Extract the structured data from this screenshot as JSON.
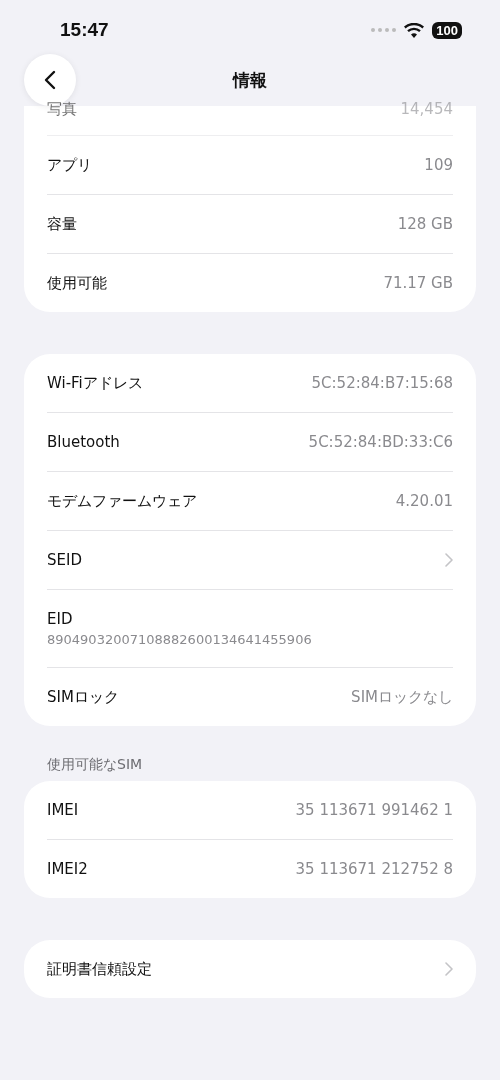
{
  "status_bar": {
    "time": "15:47",
    "battery": "100"
  },
  "nav": {
    "title": "情報"
  },
  "sections": [
    {
      "rows": [
        {
          "kind": "obscured",
          "label": "写真",
          "value": "14,454"
        },
        {
          "kind": "value",
          "label": "アプリ",
          "value": "109"
        },
        {
          "kind": "value",
          "label": "容量",
          "value": "128 GB"
        },
        {
          "kind": "value",
          "label": "使用可能",
          "value": "71.17 GB"
        }
      ]
    },
    {
      "rows": [
        {
          "kind": "value",
          "label": "Wi-Fiアドレス",
          "value": "5C:52:84:B7:15:68"
        },
        {
          "kind": "value",
          "label": "Bluetooth",
          "value": "5C:52:84:BD:33:C6"
        },
        {
          "kind": "value",
          "label": "モデムファームウェア",
          "value": "4.20.01"
        },
        {
          "kind": "link",
          "label": "SEID"
        },
        {
          "kind": "subtitle",
          "label": "EID",
          "value": "89049032007108882600134641455906"
        },
        {
          "kind": "value",
          "label": "SIMロック",
          "value": "SIMロックなし"
        }
      ]
    },
    {
      "header": "使用可能なSIM",
      "rows": [
        {
          "kind": "value",
          "label": "IMEI",
          "value": "35 113671 991462 1"
        },
        {
          "kind": "value",
          "label": "IMEI2",
          "value": "35 113671 212752 8"
        }
      ]
    },
    {
      "rows": [
        {
          "kind": "link",
          "label": "証明書信頼設定"
        }
      ]
    }
  ]
}
